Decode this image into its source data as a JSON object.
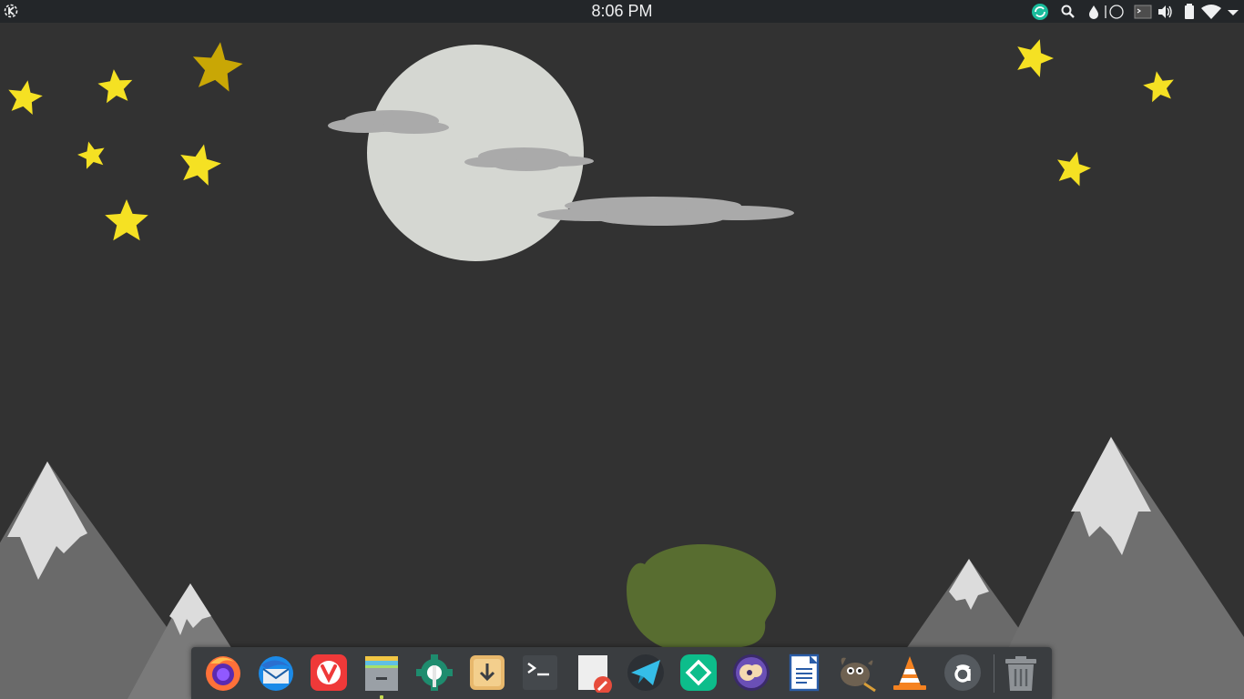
{
  "topbar": {
    "launcher_icon": "kde-logo-icon",
    "clock": "8:06 PM",
    "tray": [
      {
        "name": "sync-icon"
      },
      {
        "name": "search-icon"
      },
      {
        "name": "color-picker-icon"
      },
      {
        "name": "night-mode-icon"
      },
      {
        "name": "terminal-dropdown-icon"
      },
      {
        "name": "volume-icon"
      },
      {
        "name": "battery-icon"
      },
      {
        "name": "wifi-icon"
      },
      {
        "name": "tray-expand-icon"
      }
    ]
  },
  "dock": {
    "apps": [
      {
        "name": "firefox",
        "icon": "firefox-icon"
      },
      {
        "name": "thunderbird",
        "icon": "thunderbird-icon"
      },
      {
        "name": "vivaldi",
        "icon": "vivaldi-icon"
      },
      {
        "name": "file-manager",
        "icon": "file-manager-icon",
        "running": true
      },
      {
        "name": "software-manager",
        "icon": "software-manager-icon"
      },
      {
        "name": "download-manager",
        "icon": "download-manager-icon"
      },
      {
        "name": "terminal",
        "icon": "terminal-icon"
      },
      {
        "name": "text-editor",
        "icon": "text-editor-icon"
      },
      {
        "name": "telegram",
        "icon": "telegram-icon"
      },
      {
        "name": "element",
        "icon": "element-icon"
      },
      {
        "name": "cantata",
        "icon": "music-player-icon"
      },
      {
        "name": "writer",
        "icon": "writer-icon"
      },
      {
        "name": "gimp",
        "icon": "gimp-icon"
      },
      {
        "name": "vlc",
        "icon": "vlc-icon"
      },
      {
        "name": "amarok",
        "icon": "amarok-icon"
      }
    ],
    "trash": {
      "icon": "trash-icon"
    }
  },
  "colors": {
    "panel": "#232629",
    "desktop": "#323232",
    "moon": "#d5d7d2",
    "cloud": "#aaaaaa",
    "star": "#f5e123",
    "mountain_dark": "#5a5a5a",
    "mountain_light": "#767676",
    "snow": "#dcdcdc",
    "tree": "#586d30"
  }
}
